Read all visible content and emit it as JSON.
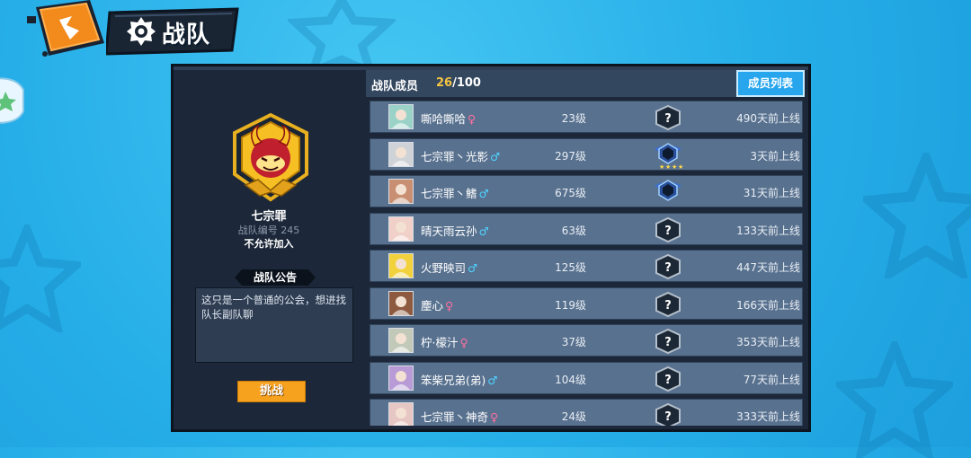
{
  "header": {
    "title": "战队",
    "back_icon": "back-arrow-icon",
    "emblem_icon": "team-emblem-icon"
  },
  "team": {
    "name": "七宗罪",
    "id_label": "战队编号 245",
    "join_policy": "不允许加入",
    "emblem_icon": "demon-crest-icon"
  },
  "notice": {
    "label": "战队公告",
    "text": "这只是一个普通的公会，想进找队长副队聊"
  },
  "challenge_label": "挑战",
  "members_panel": {
    "title": "战队成员",
    "count_current": "26",
    "count_max": "/100",
    "list_tab_label": "成员列表"
  },
  "members": [
    {
      "name": "嘶哈嘶哈",
      "gender": "♀",
      "gender_kind": "female",
      "level": "23级",
      "rank": "unranked",
      "online": "490天前上线",
      "avatar_color": "#9bd2c8"
    },
    {
      "name": "七宗罪丶光影",
      "gender": "♂",
      "gender_kind": "male",
      "level": "297级",
      "rank": "diamond-4",
      "online": "3天前上线",
      "avatar_color": "#cfd3d8"
    },
    {
      "name": "七宗罪丶鳍",
      "gender": "♂",
      "gender_kind": "male",
      "level": "675级",
      "rank": "diamond",
      "online": "31天前上线",
      "avatar_color": "#c88f73"
    },
    {
      "name": "晴天雨云孙",
      "gender": "♂",
      "gender_kind": "male",
      "level": "63级",
      "rank": "unranked",
      "online": "133天前上线",
      "avatar_color": "#f0d0c8"
    },
    {
      "name": "火野映司",
      "gender": "♂",
      "gender_kind": "male",
      "level": "125级",
      "rank": "unranked",
      "online": "447天前上线",
      "avatar_color": "#f2d23c"
    },
    {
      "name": "麈心",
      "gender": "♀",
      "gender_kind": "female",
      "level": "119级",
      "rank": "unranked",
      "online": "166天前上线",
      "avatar_color": "#8d5a3f"
    },
    {
      "name": "柠·檬汁",
      "gender": "♀",
      "gender_kind": "female",
      "level": "37级",
      "rank": "unranked",
      "online": "353天前上线",
      "avatar_color": "#c2c9b9"
    },
    {
      "name": "笨柴兄弟(弟)",
      "gender": "♂",
      "gender_kind": "male",
      "level": "104级",
      "rank": "unranked",
      "online": "77天前上线",
      "avatar_color": "#b79ad6"
    },
    {
      "name": "七宗罪丶神奇",
      "gender": "♀",
      "gender_kind": "female",
      "level": "24级",
      "rank": "unranked",
      "online": "333天前上线",
      "avatar_color": "#e7c7c4"
    }
  ],
  "colors": {
    "accent": "#f5c542",
    "button_orange": "#f7a21e",
    "tab_blue": "#27a6ee",
    "row_bg": "#58718f"
  }
}
